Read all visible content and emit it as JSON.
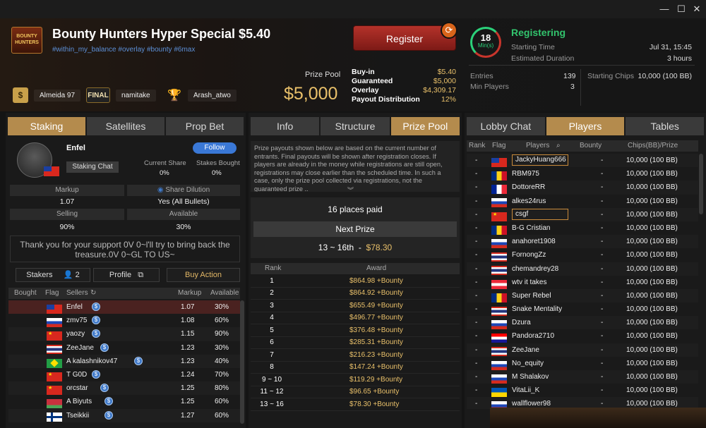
{
  "tournament": {
    "title": "Bounty Hunters Hyper Special $5.40",
    "tags": "#within_my_balance #overlay #bounty #6max",
    "logo_text": "BOUNTY HUNTERS"
  },
  "bounty_leaders": [
    {
      "name": "Almeida 97",
      "icon": "dollar-icon",
      "glyph": "$"
    },
    {
      "name": "namitake",
      "icon": "final-icon",
      "glyph": "FINAL"
    },
    {
      "name": "Arash_atwo",
      "icon": "trophy-icon",
      "glyph": "🏆"
    }
  ],
  "prize_pool": {
    "label": "Prize Pool",
    "value": "$5,000",
    "rows": [
      {
        "k": "Buy-in",
        "v": "$5.40"
      },
      {
        "k": "Guaranteed",
        "v": "$5,000"
      },
      {
        "k": "Overlay",
        "v": "$4,309.17"
      },
      {
        "k": "Payout Distribution",
        "v": "12%"
      }
    ]
  },
  "register": {
    "label": "Register",
    "early_bird_glyph": "⟳"
  },
  "timer": {
    "value": "18",
    "unit": "Min(s)",
    "progress": 0.7
  },
  "status": {
    "label": "Registering",
    "starting_time_label": "Starting Time",
    "starting_time_value": "Jul 31, 15:45",
    "duration_label": "Estimated Duration",
    "duration_value": "3 hours",
    "entries_label": "Entries",
    "entries_value": "139",
    "min_players_label": "Min Players",
    "min_players_value": "3",
    "chips_label": "Starting Chips",
    "chips_value": "10,000 (100 BB)"
  },
  "left_panel": {
    "tabs": [
      "Staking",
      "Satellites",
      "Prop Bet"
    ],
    "active_tab": 0,
    "player_name": "Enfel",
    "follow_label": "Follow",
    "staking_chat_label": "Staking Chat",
    "current_share_label": "Current Share",
    "current_share_value": "0%",
    "stakes_bought_label": "Stakes Bought",
    "stakes_bought_value": "0%",
    "markup_label": "Markup",
    "markup_value": "1.07",
    "share_dilution_label": "Share Dilution",
    "share_dilution_value": "Yes (All Bullets)",
    "selling_label": "Selling",
    "selling_value": "90%",
    "available_label": "Available",
    "available_value": "30%",
    "message": "Thank you for your support 0V 0~l'll try to bring back the treasure.0V 0~GL TO US~",
    "stakers_label": "Stakers",
    "stakers_count": "2",
    "profile_label": "Profile",
    "buy_action_label": "Buy Action",
    "table_headers": {
      "bought": "Bought",
      "flag": "Flag",
      "sellers": "Sellers",
      "markup": "Markup",
      "available": "Available"
    },
    "sellers": [
      {
        "name": "Enfel",
        "flag": "tw",
        "markup": "1.07",
        "available": "30%"
      },
      {
        "name": "zmv75",
        "flag": "ru",
        "markup": "1.08",
        "available": "60%"
      },
      {
        "name": "yaozy",
        "flag": "cn",
        "markup": "1.15",
        "available": "90%"
      },
      {
        "name": "ZeeJane",
        "flag": "th",
        "markup": "1.23",
        "available": "30%"
      },
      {
        "name": "A kalashnikov47",
        "flag": "br",
        "markup": "1.23",
        "available": "40%"
      },
      {
        "name": "T G0D",
        "flag": "cn",
        "markup": "1.24",
        "available": "70%"
      },
      {
        "name": "orcstar",
        "flag": "cn",
        "markup": "1.25",
        "available": "80%"
      },
      {
        "name": "A Biyuts",
        "flag": "by",
        "markup": "1.25",
        "available": "60%"
      },
      {
        "name": "Tseikkii",
        "flag": "fi",
        "markup": "1.27",
        "available": "60%"
      }
    ]
  },
  "middle_panel": {
    "tabs": [
      "Info",
      "Structure",
      "Prize Pool"
    ],
    "active_tab": 2,
    "notice": "Prize payouts shown below are based on the current number of entrants. Final payouts will be shown after registration closes. If players are already in the money while registrations are still open, registrations may close earlier than the scheduled time. In such a case, only the prize pool collected via registrations, not the guaranteed prize ..",
    "places_paid": "16 places paid",
    "next_prize_label": "Next Prize",
    "next_prize_range": "13 ~ 16th",
    "next_prize_sep": "-",
    "next_prize_value": "$78.30",
    "headers": {
      "rank": "Rank",
      "award": "Award"
    },
    "awards": [
      {
        "rank": "1",
        "award": "$864.98 +Bounty"
      },
      {
        "rank": "2",
        "award": "$864.92 +Bounty"
      },
      {
        "rank": "3",
        "award": "$655.49 +Bounty"
      },
      {
        "rank": "4",
        "award": "$496.77 +Bounty"
      },
      {
        "rank": "5",
        "award": "$376.48 +Bounty"
      },
      {
        "rank": "6",
        "award": "$285.31 +Bounty"
      },
      {
        "rank": "7",
        "award": "$216.23 +Bounty"
      },
      {
        "rank": "8",
        "award": "$147.24 +Bounty"
      },
      {
        "rank": "9 ~ 10",
        "award": "$119.29 +Bounty"
      },
      {
        "rank": "11 ~ 12",
        "award": "$96.65 +Bounty"
      },
      {
        "rank": "13 ~ 16",
        "award": "$78.30 +Bounty"
      }
    ]
  },
  "right_panel": {
    "tabs": [
      "Lobby Chat",
      "Players",
      "Tables"
    ],
    "active_tab": 1,
    "headers": {
      "rank": "Rank",
      "flag": "Flag",
      "players": "Players",
      "bounty": "Bounty",
      "chips": "Chips(BB)/Prize"
    },
    "players": [
      {
        "rank": "-",
        "flag": "tw",
        "name": "JackyHuang666",
        "bounty": "-",
        "chips": "10,000 (100 BB)",
        "boxed": true
      },
      {
        "rank": "-",
        "flag": "ro",
        "name": "RBM975",
        "bounty": "-",
        "chips": "10,000 (100 BB)"
      },
      {
        "rank": "-",
        "flag": "fr",
        "name": "DottoreRR",
        "bounty": "-",
        "chips": "10,000 (100 BB)"
      },
      {
        "rank": "-",
        "flag": "ru",
        "name": "alkes24rus",
        "bounty": "-",
        "chips": "10,000 (100 BB)"
      },
      {
        "rank": "-",
        "flag": "cn",
        "name": "csgf",
        "bounty": "-",
        "chips": "10,000 (100 BB)",
        "boxed": true
      },
      {
        "rank": "-",
        "flag": "ro",
        "name": "B-G Cristian",
        "bounty": "-",
        "chips": "10,000 (100 BB)"
      },
      {
        "rank": "-",
        "flag": "ru",
        "name": "anahoret1908",
        "bounty": "-",
        "chips": "10,000 (100 BB)"
      },
      {
        "rank": "-",
        "flag": "th",
        "name": "FornongZz",
        "bounty": "-",
        "chips": "10,000 (100 BB)"
      },
      {
        "rank": "-",
        "flag": "th",
        "name": "chemandrey28",
        "bounty": "-",
        "chips": "10,000 (100 BB)"
      },
      {
        "rank": "-",
        "flag": "at",
        "name": "wtv it takes",
        "bounty": "-",
        "chips": "10,000 (100 BB)"
      },
      {
        "rank": "-",
        "flag": "ro",
        "name": "Super Rebel",
        "bounty": "-",
        "chips": "10,000 (100 BB)"
      },
      {
        "rank": "-",
        "flag": "th",
        "name": "Snake Mentality",
        "bounty": "-",
        "chips": "10,000 (100 BB)"
      },
      {
        "rank": "-",
        "flag": "ru",
        "name": "Dzura",
        "bounty": "-",
        "chips": "10,000 (100 BB)"
      },
      {
        "rank": "-",
        "flag": "hr",
        "name": "Pandora2710",
        "bounty": "-",
        "chips": "10,000 (100 BB)"
      },
      {
        "rank": "-",
        "flag": "th",
        "name": "ZeeJane",
        "bounty": "-",
        "chips": "10,000 (100 BB)"
      },
      {
        "rank": "-",
        "flag": "ru",
        "name": "No_equity",
        "bounty": "-",
        "chips": "10,000 (100 BB)"
      },
      {
        "rank": "-",
        "flag": "ru",
        "name": "M Shalakov",
        "bounty": "-",
        "chips": "10,000 (100 BB)"
      },
      {
        "rank": "-",
        "flag": "ua",
        "name": "VitaLii_K",
        "bounty": "-",
        "chips": "10,000 (100 BB)"
      },
      {
        "rank": "-",
        "flag": "ru",
        "name": "wallflower98",
        "bounty": "-",
        "chips": "10,000 (100 BB)"
      }
    ]
  },
  "window_controls": {
    "minimize": "—",
    "maximize": "☐",
    "close": "✕"
  },
  "colors": {
    "accent_gold": "#b48b4d",
    "prize_gold": "#e9c06a",
    "register_red": "#9b2620",
    "status_green": "#32c46d"
  }
}
